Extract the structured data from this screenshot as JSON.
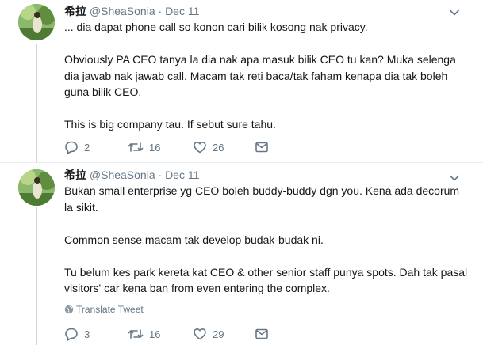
{
  "tweets": [
    {
      "name": "希拉",
      "handle": "@SheaSonia",
      "separator": "·",
      "date": "Dec 11",
      "text": "... dia dapat phone call so konon cari bilik kosong nak privacy.\n\nObviously PA CEO tanya la dia nak apa masuk bilik CEO tu kan? Muka selenga dia jawab nak jawab call. Macam tak reti baca/tak faham kenapa dia tak boleh guna bilik CEO.\n\nThis is big company tau. If sebut sure tahu.",
      "replies": "2",
      "retweets": "16",
      "likes": "26"
    },
    {
      "name": "希拉",
      "handle": "@SheaSonia",
      "separator": "·",
      "date": "Dec 11",
      "text": "Bukan small enterprise yg CEO boleh buddy-buddy dgn you. Kena ada decorum la sikit.\n\nCommon sense macam tak develop budak-budak ni.\n\nTu belum kes park kereta kat CEO & other senior staff punya spots. Dah tak pasal visitors' car kena ban from even entering the complex.",
      "translate_label": "Translate Tweet",
      "replies": "3",
      "retweets": "16",
      "likes": "29"
    }
  ],
  "icons": {
    "reply": "reply-icon",
    "retweet": "retweet-icon",
    "like": "heart-icon",
    "dm": "envelope-icon",
    "more": "chevron-down-icon",
    "translate": "globe-icon"
  },
  "colors": {
    "text": "#14171a",
    "muted": "#657786",
    "thread_line": "#ccd6dd",
    "divider": "#e6ecf0"
  }
}
